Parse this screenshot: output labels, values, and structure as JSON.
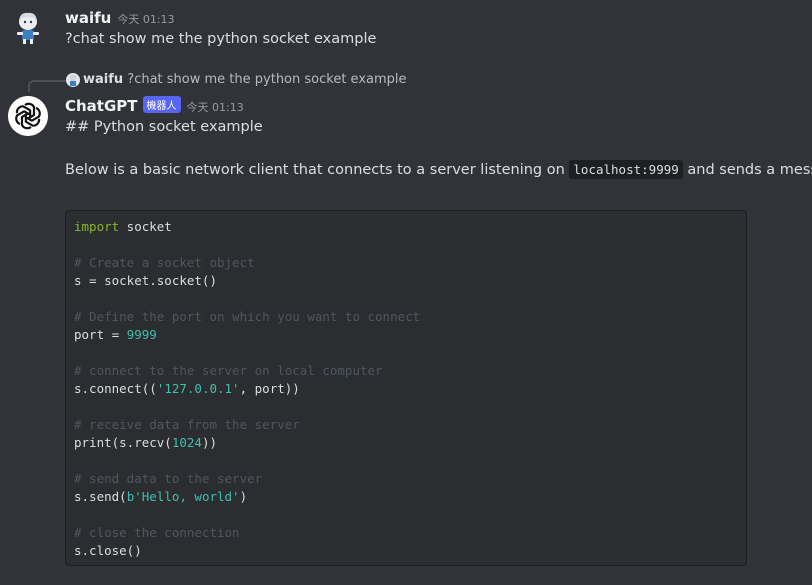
{
  "messages": [
    {
      "author": "waifu",
      "timestamp": "今天 01:13",
      "content": "?chat show me the python socket example"
    },
    {
      "reply_to": {
        "author": "waifu",
        "content": "?chat show me the python socket example"
      },
      "author": "ChatGPT",
      "badge": "機器人",
      "timestamp": "今天 01:13",
      "heading": "## Python socket example",
      "paragraph_before": "Below is a basic network client that connects to a server listening on",
      "inline_code": "localhost:9999",
      "paragraph_after": "and sends a message.",
      "code": [
        {
          "parts": [
            {
              "t": "import",
              "c": "kw2"
            },
            {
              "t": " socket",
              "c": ""
            }
          ]
        },
        {
          "parts": []
        },
        {
          "parts": [
            {
              "t": "# Create a socket object",
              "c": "cmt"
            }
          ]
        },
        {
          "parts": [
            {
              "t": "s = socket.socket()",
              "c": ""
            }
          ]
        },
        {
          "parts": []
        },
        {
          "parts": [
            {
              "t": "# Define the port on which you want to connect",
              "c": "cmt"
            }
          ]
        },
        {
          "parts": [
            {
              "t": "port = ",
              "c": ""
            },
            {
              "t": "9999",
              "c": "num"
            }
          ]
        },
        {
          "parts": []
        },
        {
          "parts": [
            {
              "t": "# connect to the server on local computer",
              "c": "cmt"
            }
          ]
        },
        {
          "parts": [
            {
              "t": "s.connect((",
              "c": ""
            },
            {
              "t": "'127.0.0.1'",
              "c": "str"
            },
            {
              "t": ", port))",
              "c": ""
            }
          ]
        },
        {
          "parts": []
        },
        {
          "parts": [
            {
              "t": "# receive data from the server",
              "c": "cmt"
            }
          ]
        },
        {
          "parts": [
            {
              "t": "print(s.recv(",
              "c": ""
            },
            {
              "t": "1024",
              "c": "num"
            },
            {
              "t": "))",
              "c": ""
            }
          ]
        },
        {
          "parts": []
        },
        {
          "parts": [
            {
              "t": "# send data to the server",
              "c": "cmt"
            }
          ]
        },
        {
          "parts": [
            {
              "t": "s.send(",
              "c": ""
            },
            {
              "t": "b'Hello, world'",
              "c": "str"
            },
            {
              "t": ")",
              "c": ""
            }
          ]
        },
        {
          "parts": []
        },
        {
          "parts": [
            {
              "t": "# close the connection",
              "c": "cmt"
            }
          ]
        },
        {
          "parts": [
            {
              "t": "s.close()",
              "c": ""
            }
          ]
        }
      ]
    }
  ],
  "colors": {
    "background": "#313338",
    "code_background": "#2b2d31",
    "bot_badge": "#5865f2",
    "keyword": "#8ab52c",
    "comment": "#4f5660",
    "literal": "#3fbfad"
  },
  "icons": {
    "waifu_avatar": "anime-girl-avatar",
    "chatgpt_avatar": "openai-logo"
  }
}
